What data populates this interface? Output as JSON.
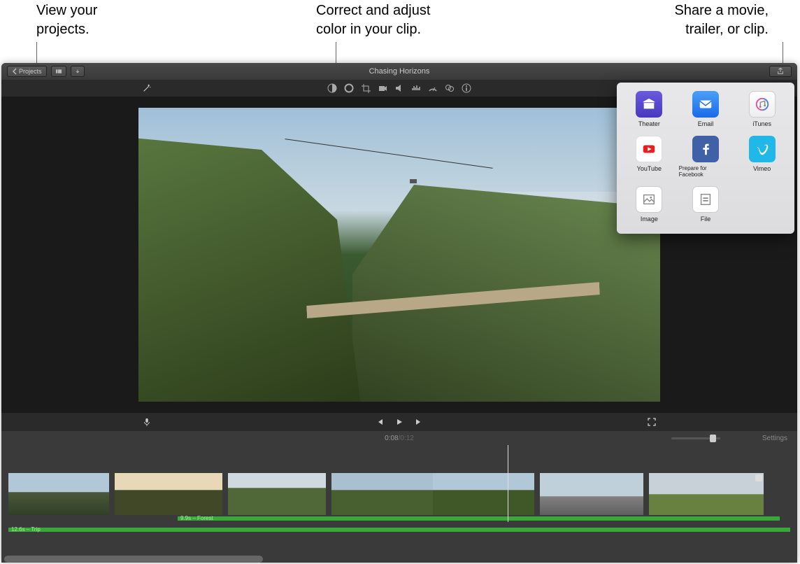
{
  "callouts": {
    "left_l1": "View your",
    "left_l2": "projects.",
    "mid_l1": "Correct and adjust",
    "mid_l2": "color in your clip.",
    "right_l1": "Share a movie,",
    "right_l2": "trailer, or clip."
  },
  "titlebar": {
    "projects_btn": "Projects",
    "title": "Chasing Horizons"
  },
  "adjust_tools": [
    "color-balance-icon",
    "color-correction-icon",
    "crop-icon",
    "stabilization-icon",
    "volume-icon",
    "noise-reduction-icon",
    "speed-icon",
    "filter-icon",
    "info-icon"
  ],
  "playback": {
    "current": "0:08",
    "separator": " / ",
    "total": "0:12"
  },
  "timerow": {
    "settings": "Settings"
  },
  "timeline": {
    "audio1_label": "9.9s – Forest",
    "audio2_label": "12.6s – Trip"
  },
  "share": {
    "items": [
      {
        "label": "Theater",
        "icon": "theater"
      },
      {
        "label": "Email",
        "icon": "email"
      },
      {
        "label": "iTunes",
        "icon": "itunes"
      },
      {
        "label": "YouTube",
        "icon": "youtube"
      },
      {
        "label": "Prepare for Facebook",
        "icon": "facebook"
      },
      {
        "label": "Vimeo",
        "icon": "vimeo"
      },
      {
        "label": "Image",
        "icon": "image"
      },
      {
        "label": "File",
        "icon": "file"
      }
    ]
  }
}
